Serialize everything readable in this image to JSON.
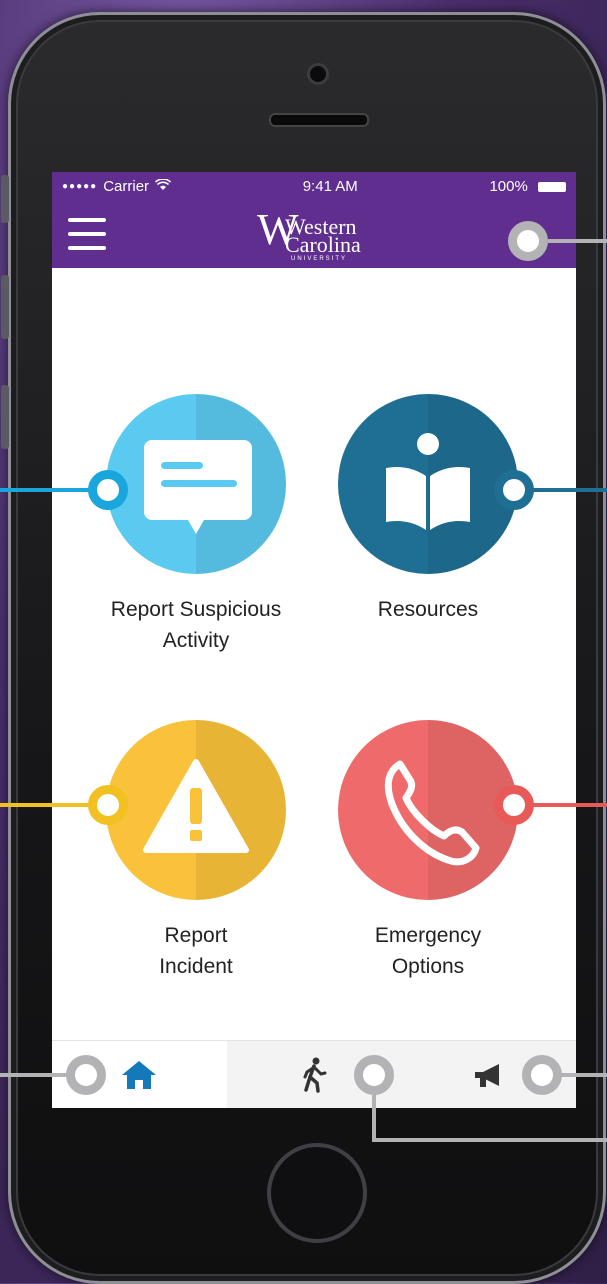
{
  "status_bar": {
    "signal": "●●●●●",
    "carrier": "Carrier",
    "time": "9:41 AM",
    "battery": "100%"
  },
  "header": {
    "logo_line1": "Western",
    "logo_line2": "Carolina",
    "logo_sub": "UNIVERSITY",
    "brand_color": "#5f2e8f"
  },
  "tiles": [
    {
      "id": "report-suspicious",
      "label_line1": "Report Suspicious",
      "label_line2": "Activity",
      "icon": "chat-bubble-icon",
      "color": "#5bcaf0"
    },
    {
      "id": "resources",
      "label_line1": "Resources",
      "label_line2": "",
      "icon": "book-reader-icon",
      "color": "#1f6f95"
    },
    {
      "id": "report-incident",
      "label_line1": "Report",
      "label_line2": "Incident",
      "icon": "warning-icon",
      "color": "#f9c23a"
    },
    {
      "id": "emergency-options",
      "label_line1": "Emergency",
      "label_line2": "Options",
      "icon": "phone-icon",
      "color": "#ef6b6b"
    }
  ],
  "tabs": [
    {
      "name": "home",
      "icon": "home-icon",
      "color": "#1479b8"
    },
    {
      "name": "walk",
      "icon": "walking-person-icon",
      "color": "#333333"
    },
    {
      "name": "alerts",
      "icon": "megaphone-icon",
      "color": "#333333"
    }
  ],
  "callout_colors": {
    "gray": "#b3b3b6",
    "blue": "#19a6dc",
    "navy": "#1f6f95",
    "yellow": "#f2c021",
    "red": "#e85a58"
  }
}
